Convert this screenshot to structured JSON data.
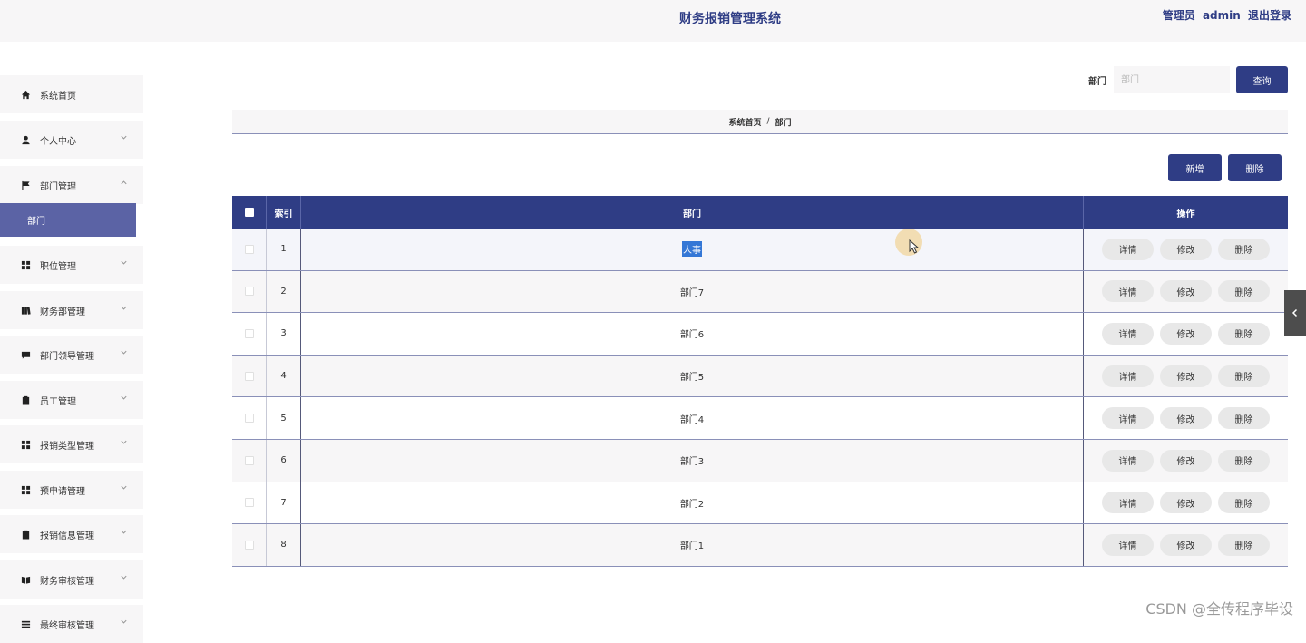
{
  "header": {
    "title": "财务报销管理系统",
    "role": "管理员",
    "username": "admin",
    "logout": "退出登录"
  },
  "sidebar": {
    "items": [
      {
        "label": "系统首页",
        "icon": "home-icon",
        "expandable": false
      },
      {
        "label": "个人中心",
        "icon": "user-icon",
        "expandable": true
      },
      {
        "label": "部门管理",
        "icon": "flag-icon",
        "expandable": true,
        "expanded": true
      },
      {
        "label": "职位管理",
        "icon": "grid-icon",
        "expandable": true
      },
      {
        "label": "财务部管理",
        "icon": "book-icon",
        "expandable": true
      },
      {
        "label": "部门领导管理",
        "icon": "chat-icon",
        "expandable": true
      },
      {
        "label": "员工管理",
        "icon": "clipboard-icon",
        "expandable": true
      },
      {
        "label": "报销类型管理",
        "icon": "grid-icon",
        "expandable": true
      },
      {
        "label": "预申请管理",
        "icon": "grid-icon",
        "expandable": true
      },
      {
        "label": "报销信息管理",
        "icon": "clipboard-x-icon",
        "expandable": true
      },
      {
        "label": "财务审核管理",
        "icon": "book-open-icon",
        "expandable": true
      },
      {
        "label": "最终审核管理",
        "icon": "list-icon",
        "expandable": true
      }
    ],
    "sub_item": "部门"
  },
  "search": {
    "label": "部门",
    "placeholder": "部门",
    "button": "查询"
  },
  "breadcrumb": {
    "home": "系统首页",
    "separator": "/",
    "current": "部门"
  },
  "actions": {
    "add": "新增",
    "delete": "删除"
  },
  "table": {
    "headers": {
      "index": "索引",
      "dept": "部门",
      "ops": "操作"
    },
    "op_labels": {
      "detail": "详情",
      "edit": "修改",
      "delete": "删除"
    },
    "rows": [
      {
        "index": "1",
        "dept": "人事"
      },
      {
        "index": "2",
        "dept": "部门7"
      },
      {
        "index": "3",
        "dept": "部门6"
      },
      {
        "index": "4",
        "dept": "部门5"
      },
      {
        "index": "5",
        "dept": "部门4"
      },
      {
        "index": "6",
        "dept": "部门3"
      },
      {
        "index": "7",
        "dept": "部门2"
      },
      {
        "index": "8",
        "dept": "部门1"
      }
    ]
  },
  "watermark": "CSDN @全传程序毕设",
  "colors": {
    "accent": "#2f3d85",
    "submenu_active": "#5b63a5",
    "panel_bg": "#f7f6f7",
    "op_button_bg": "#e8e8e8"
  }
}
